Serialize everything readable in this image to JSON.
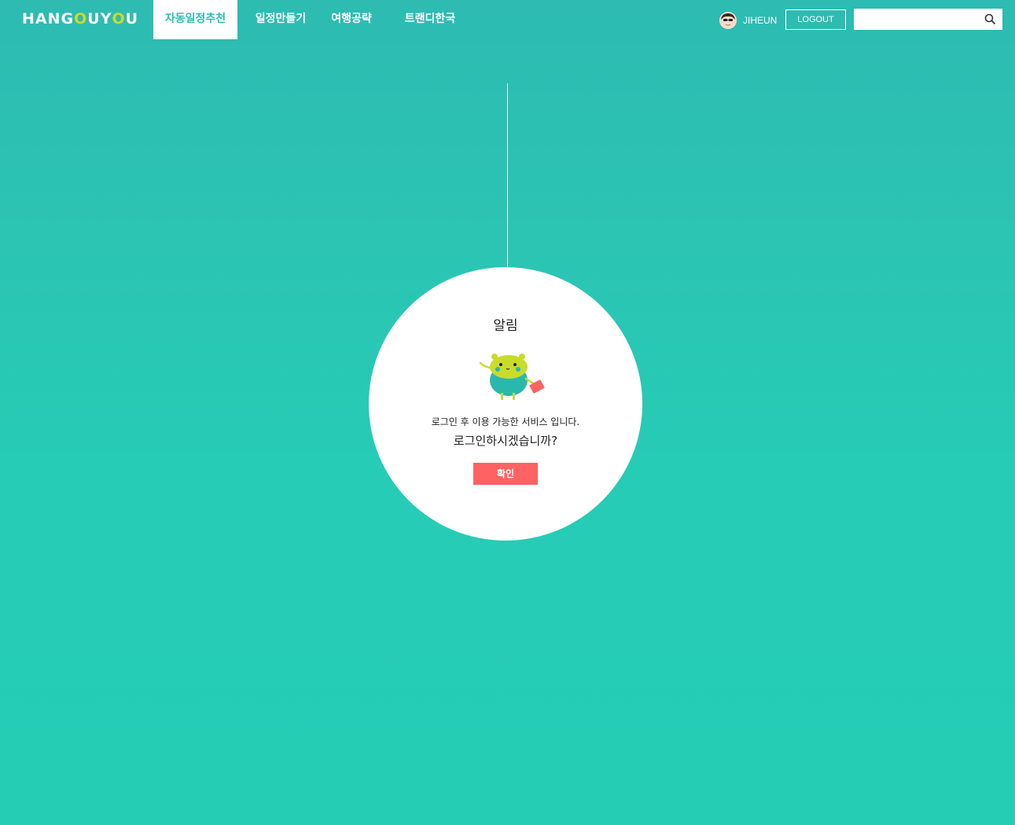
{
  "header": {
    "logo": {
      "part1": "HANG",
      "o1": "O",
      "part2": "UY",
      "o2": "O",
      "part3": "U"
    },
    "nav": [
      {
        "label": "자동일정추천",
        "active": true
      },
      {
        "label": "일정만들기",
        "active": false
      },
      {
        "label": "여행공략",
        "active": false
      },
      {
        "label": "트랜디한국",
        "active": false
      }
    ],
    "user": {
      "name": "JIHEUN",
      "icon": "avatar"
    },
    "logout_label": "LOGOUT",
    "search": {
      "value": "",
      "placeholder": "",
      "icon": "search-icon"
    }
  },
  "modal": {
    "title": "알림",
    "mascot": "bear-mascot",
    "message_line1": "로그인 후 이용 가능한 서비스 입니다.",
    "message_line2": "로그인하시겠습니까?",
    "confirm_label": "확인"
  },
  "colors": {
    "background": "#25cdb5",
    "accent": "#2cbfb2",
    "logo_o": "#c9dc2b",
    "confirm_button": "#ff6262"
  }
}
